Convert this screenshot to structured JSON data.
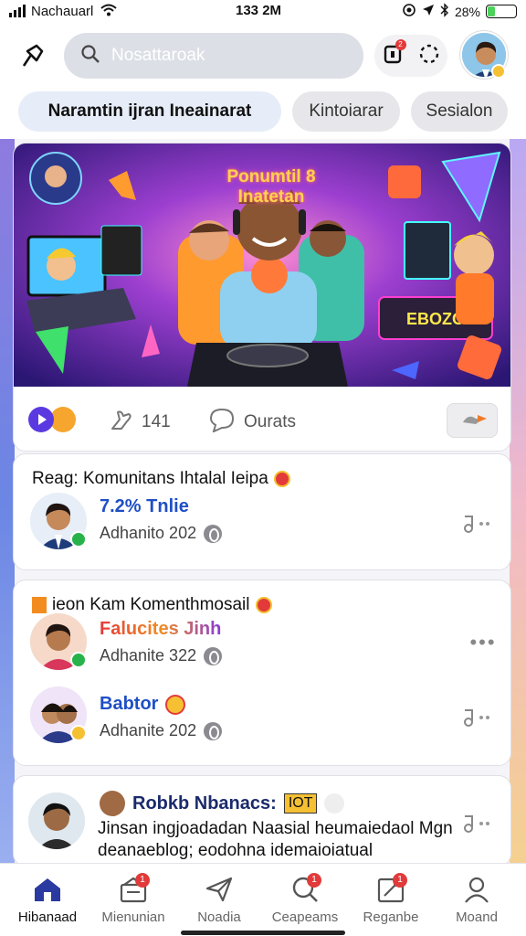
{
  "status_bar": {
    "carrier": "Nachauarl",
    "time": "133 2M",
    "battery": "28%",
    "battery_level": 0.28
  },
  "header": {
    "search_placeholder": "Nosattaroak",
    "notification_count": "2",
    "icons": [
      "app-logo-icon",
      "search-icon",
      "notification-icon",
      "loading-icon"
    ]
  },
  "chips": [
    {
      "label": "Naramtin ijran Ineainarat",
      "active": true
    },
    {
      "label": "Kintoiarar",
      "active": false
    },
    {
      "label": "Sesialon",
      "active": false
    }
  ],
  "feature": {
    "banner_title_line1": "Ponumtil 8",
    "banner_title_line2": "Inatetan",
    "banner_sign": "EBOZO",
    "like_count": "141",
    "comment_label": "Ourats"
  },
  "posts": [
    {
      "group_title": "Reag: Komunitans Ihtalal Ieipa",
      "author": "7.2% Tnlie",
      "meta": "Adhanito 202",
      "accent": "#1a9a3a"
    }
  ],
  "group2": {
    "title": "ieon Kam Komenthmosail",
    "entries": [
      {
        "author": "Falucites Jinh",
        "meta": "Adhanite 322"
      },
      {
        "author": "Babtor",
        "meta": "Adhanite 202"
      }
    ]
  },
  "post3": {
    "author": "Robkb Nbanacs:",
    "badge": "IOT",
    "body": "Jinsan ingjoadadan Naasial heumaiedaol Mgn deanaeblog; eodohna idemaioiatual"
  },
  "bottom_nav": [
    {
      "label": "Hibanaad",
      "icon": "home-icon",
      "active": true,
      "badge": ""
    },
    {
      "label": "Mienunian",
      "icon": "bag-icon",
      "active": false,
      "badge": "1"
    },
    {
      "label": "Noadia",
      "icon": "paper-plane-icon",
      "active": false,
      "badge": ""
    },
    {
      "label": "Ceapeams",
      "icon": "search-icon",
      "active": false,
      "badge": "1"
    },
    {
      "label": "Reganbe",
      "icon": "gallery-icon",
      "active": false,
      "badge": "1"
    },
    {
      "label": "Moand",
      "icon": "profile-icon",
      "active": false,
      "badge": ""
    }
  ],
  "colors": {
    "accent_blue": "#1f4fc6",
    "badge_red": "#e23a3a",
    "online_green": "#28b34a"
  }
}
